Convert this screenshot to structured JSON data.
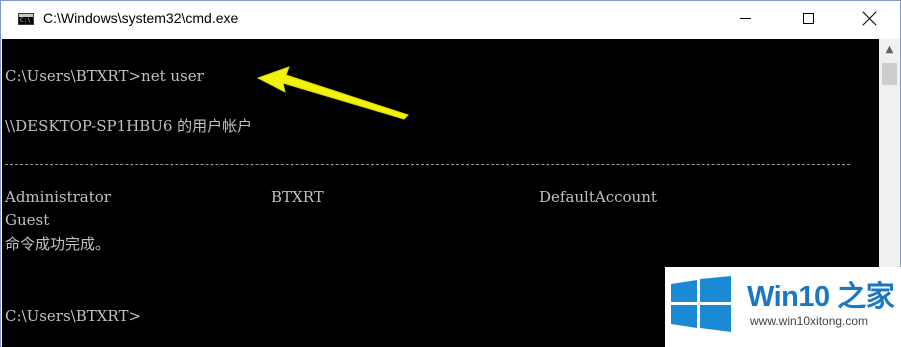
{
  "window": {
    "title": "C:\\Windows\\system32\\cmd.exe"
  },
  "console": {
    "lines": [
      "C:\\Users\\BTXRT>net user",
      "\\\\DESKTOP-SP1HBU6 的用户帐户",
      "Guest",
      "命令成功完成。",
      "C:\\Users\\BTXRT>"
    ],
    "accounts_row": [
      "Administrator",
      "BTXRT",
      "DefaultAccount"
    ],
    "separator": "-----------------------------------------------------------------------------"
  },
  "annotation": {
    "arrow_color": "#f2f20a"
  },
  "watermark": {
    "brand_prefix": "Win10",
    "brand_suffix": "之家",
    "url": "www.win10xitong.com",
    "brand_color": "#1a78c2"
  },
  "icons": {
    "app": "cmd-icon",
    "minimize": "minimize-icon",
    "maximize": "maximize-icon",
    "close": "close-icon",
    "scroll_up": "chevron-up-icon"
  }
}
